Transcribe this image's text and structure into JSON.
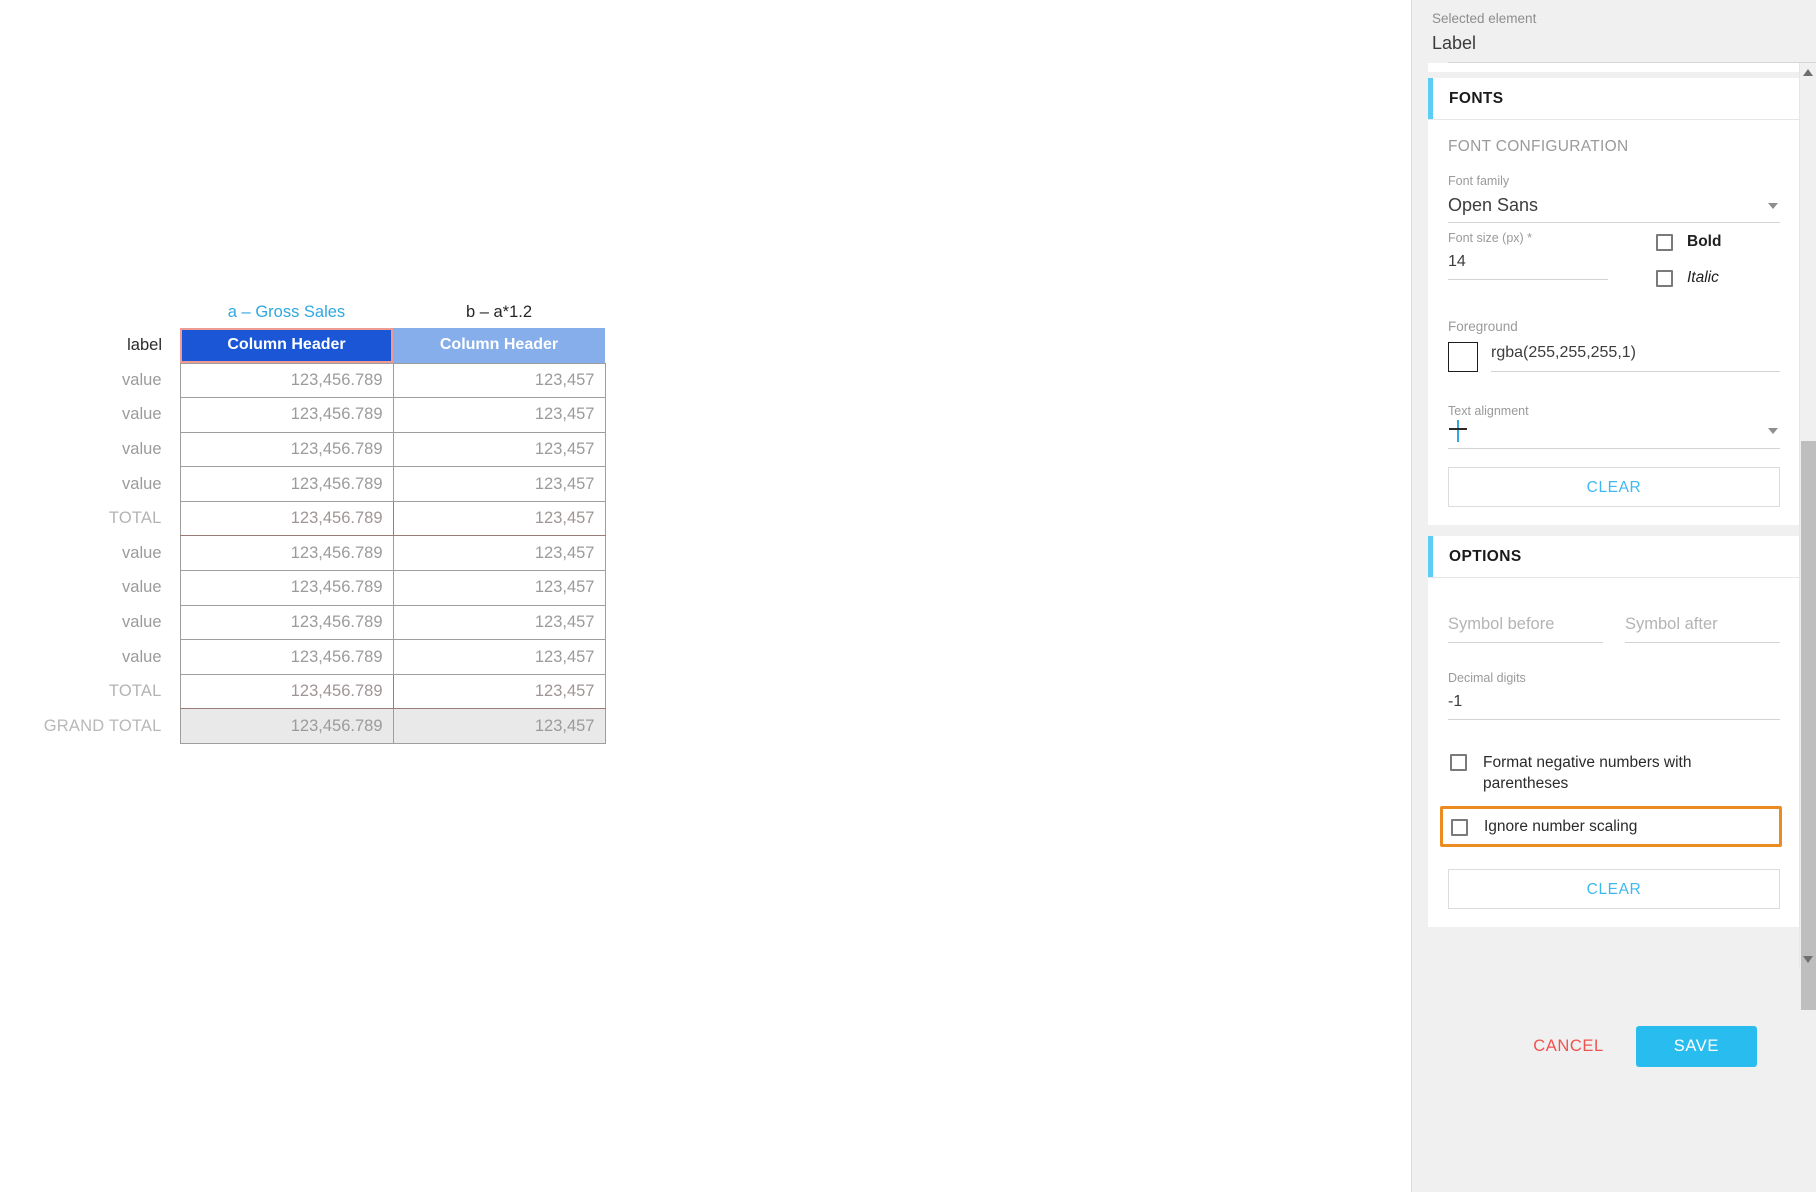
{
  "canvas": {
    "table": {
      "formula_a": "a – Gross Sales",
      "formula_b": "b – a*1.2",
      "header_label": "label",
      "header_a": "Column Header",
      "header_b": "Column Header",
      "rows": [
        {
          "label": "value",
          "a": "123,456.789",
          "b": "123,457",
          "kind": "value"
        },
        {
          "label": "value",
          "a": "123,456.789",
          "b": "123,457",
          "kind": "value"
        },
        {
          "label": "value",
          "a": "123,456.789",
          "b": "123,457",
          "kind": "value"
        },
        {
          "label": "value",
          "a": "123,456.789",
          "b": "123,457",
          "kind": "value"
        },
        {
          "label": "TOTAL",
          "a": "123,456.789",
          "b": "123,457",
          "kind": "total"
        },
        {
          "label": "value",
          "a": "123,456.789",
          "b": "123,457",
          "kind": "value"
        },
        {
          "label": "value",
          "a": "123,456.789",
          "b": "123,457",
          "kind": "value"
        },
        {
          "label": "value",
          "a": "123,456.789",
          "b": "123,457",
          "kind": "value"
        },
        {
          "label": "value",
          "a": "123,456.789",
          "b": "123,457",
          "kind": "value"
        },
        {
          "label": "TOTAL",
          "a": "123,456.789",
          "b": "123,457",
          "kind": "total"
        },
        {
          "label": "GRAND TOTAL",
          "a": "123,456.789",
          "b": "123,457",
          "kind": "grand"
        }
      ]
    }
  },
  "panel": {
    "selected_caption": "Selected element",
    "selected_value": "Label",
    "fonts": {
      "card_title": "FONTS",
      "section_caption": "FONT CONFIGURATION",
      "font_family_label": "Font family",
      "font_family_value": "Open Sans",
      "font_size_label": "Font size (px) *",
      "font_size_value": "14",
      "bold_label": "Bold",
      "italic_label": "Italic",
      "bold_checked": false,
      "italic_checked": false,
      "foreground_label": "Foreground",
      "foreground_value": "rgba(255,255,255,1)",
      "foreground_swatch": "#ffffff",
      "text_alignment_label": "Text alignment",
      "text_alignment_value": "",
      "clear_label": "CLEAR"
    },
    "options": {
      "card_title": "OPTIONS",
      "symbol_before_placeholder": "Symbol before",
      "symbol_before_value": "",
      "symbol_after_placeholder": "Symbol after",
      "symbol_after_value": "",
      "decimal_digits_label": "Decimal digits",
      "decimal_digits_value": "-1",
      "format_negative_label": "Format negative numbers with parentheses",
      "format_negative_checked": false,
      "ignore_scaling_label": "Ignore number scaling",
      "ignore_scaling_checked": false,
      "clear_label": "CLEAR"
    },
    "footer": {
      "cancel_label": "CANCEL",
      "save_label": "SAVE"
    },
    "colors": {
      "accent": "#5ccdf4",
      "save_button": "#29bdef",
      "cancel_text": "#ef5350",
      "clear_text": "#3fb8ef",
      "highlight_box": "#ec8b20",
      "header_a_bg": "#1a56d6",
      "header_b_bg": "#85aeea",
      "selection_outline": "#ef9a93"
    }
  }
}
